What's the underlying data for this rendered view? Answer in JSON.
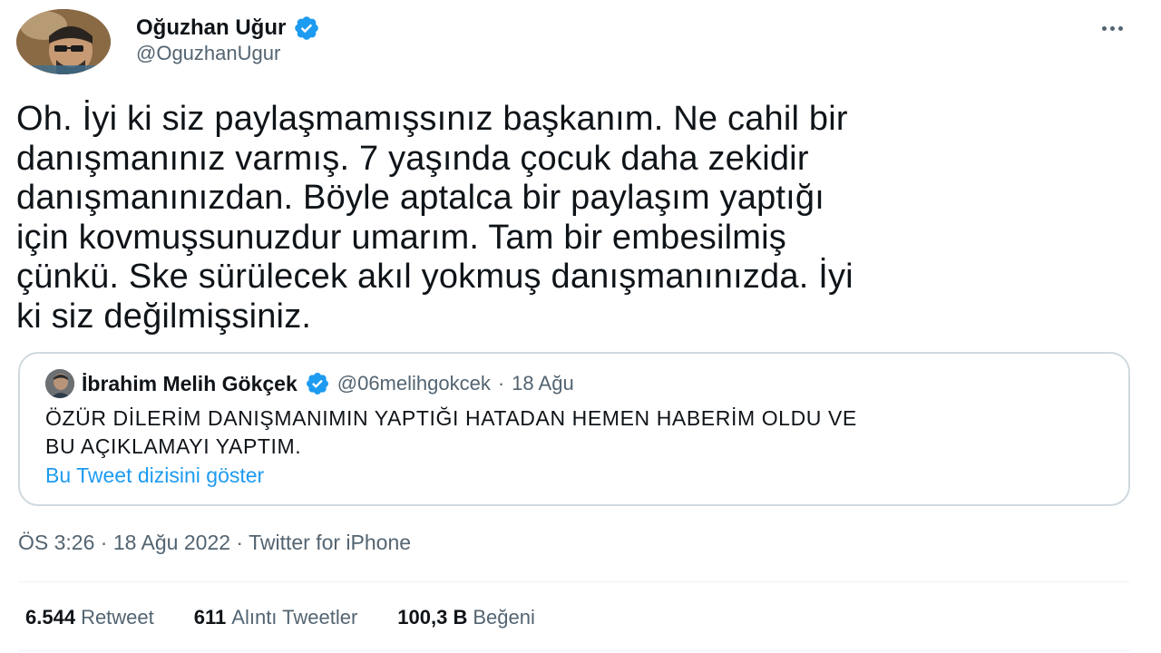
{
  "tweet": {
    "author": {
      "name": "Oğuzhan Uğur",
      "handle": "@OguzhanUgur",
      "verified": true,
      "avatar_icon": "profile-photo"
    },
    "more_icon": "more-horizontal-icon",
    "text_lines": [
      "Oh. İyi ki siz paylaşmamışsınız başkanım. Ne cahil bir",
      "danışmanınız varmış. 7 yaşında çocuk daha zekidir",
      "danışmanınızdan. Böyle aptalca bir paylaşım yaptığı",
      "için kovmuşsunuzdur umarım. Tam bir embesilmiş",
      "çünkü. Ske sürülecek akıl yokmuş danışmanınızda. İyi",
      "ki siz değilmişsiniz."
    ],
    "quoted": {
      "author_name": "İbrahim Melih Gökçek",
      "handle": "@06melihgokcek",
      "separator": "·",
      "date": "18 Ağu",
      "verified": true,
      "text_lines": [
        "ÖZÜR DİLERİM DANIŞMANIMIN YAPTIĞI HATADAN HEMEN HABERİM OLDU VE",
        "BU AÇIKLAMAYI YAPTIM."
      ],
      "thread_link": "Bu Tweet dizisini göster"
    },
    "meta": {
      "time": "ÖS 3:26",
      "separator": "·",
      "date": "18 Ağu 2022",
      "source": "Twitter for iPhone"
    },
    "stats": {
      "retweets": {
        "count": "6.544",
        "label": "Retweet"
      },
      "quotes": {
        "count": "611",
        "label": "Alıntı Tweetler"
      },
      "likes": {
        "count": "100,3 B",
        "label": "Beğeni"
      }
    }
  },
  "colors": {
    "text": "#0f1419",
    "secondary": "#536471",
    "link": "#1d9bf0",
    "verified": "#1d9bf0",
    "border": "#cfd9de"
  }
}
